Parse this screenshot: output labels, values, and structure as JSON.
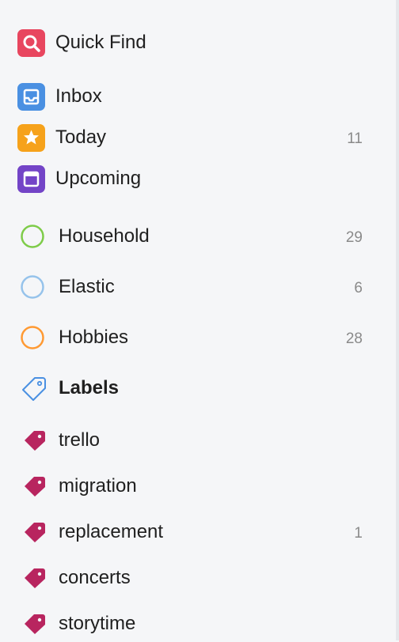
{
  "nav": {
    "quick_find": {
      "label": "Quick Find",
      "icon": "search-icon",
      "color": "#e8465f"
    },
    "inbox": {
      "label": "Inbox",
      "icon": "inbox-icon",
      "color": "#4a90e2"
    },
    "today": {
      "label": "Today",
      "icon": "star-icon",
      "color": "#f6a21b",
      "count": "11"
    },
    "upcoming": {
      "label": "Upcoming",
      "icon": "calendar-icon",
      "color": "#7344c7"
    }
  },
  "projects": [
    {
      "label": "Household",
      "count": "29",
      "color": "#7ecc49"
    },
    {
      "label": "Elastic",
      "count": "6",
      "color": "#96c3eb"
    },
    {
      "label": "Hobbies",
      "count": "28",
      "color": "#ff9a33"
    }
  ],
  "labels_header": {
    "label": "Labels",
    "icon": "label-outline-icon",
    "color": "#4a90e2"
  },
  "labels": [
    {
      "label": "trello",
      "count": "",
      "color": "#b8255f"
    },
    {
      "label": "migration",
      "count": "",
      "color": "#b8255f"
    },
    {
      "label": "replacement",
      "count": "1",
      "color": "#b8255f"
    },
    {
      "label": "concerts",
      "count": "",
      "color": "#b8255f"
    },
    {
      "label": "storytime",
      "count": "",
      "color": "#b8255f"
    }
  ]
}
